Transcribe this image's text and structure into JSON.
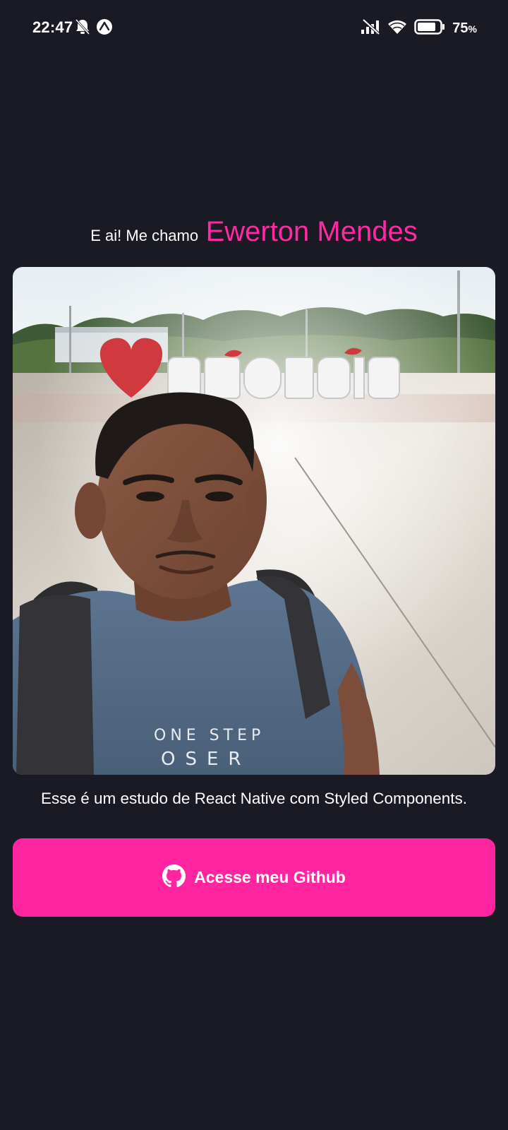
{
  "status_bar": {
    "time": "22:47",
    "battery_level": "75",
    "battery_unit": "%",
    "icons_left": [
      "bell-off-icon",
      "expo-icon"
    ],
    "icons_right": [
      "no-signal-icon",
      "wifi-icon",
      "battery-icon"
    ]
  },
  "greeting": {
    "prefix": "E ai! Me chamo",
    "name": "Ewerton Mendes"
  },
  "description": "Esse é um estudo de React Native com Styled Components.",
  "github_button": {
    "label": "Acesse meu Github",
    "icon": "github-icon"
  },
  "colors": {
    "background": "#1a1a24",
    "accent": "#ff24a0",
    "text": "#ffffff"
  }
}
